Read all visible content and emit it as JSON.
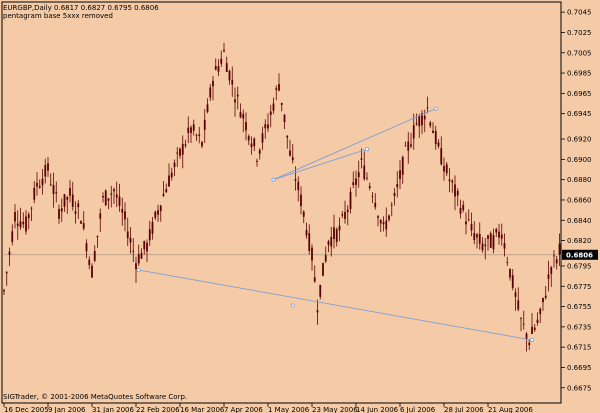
{
  "header": {
    "symbol_line": "EURGBP,Daily  0.6817 0.6827 0.6795 0.6806",
    "indicator_line": "pentagram base 5xxx removed"
  },
  "footer": {
    "copyright": "SIGTrader, © 2001-2006 MetaQuotes Software Corp."
  },
  "colors": {
    "background": "#f5cba7",
    "candle": "#5a0000",
    "pattern_line": "#7f9fd4",
    "price_line": "#a08c78",
    "current_price_box": "#000000",
    "current_price_text": "#ffffff",
    "axis": "#000000"
  },
  "chart_data": {
    "type": "candlestick",
    "symbol": "EURGBP",
    "timeframe": "Daily",
    "last_bar": {
      "open": 0.6817,
      "high": 0.6827,
      "low": 0.6795,
      "close": 0.6806
    },
    "current_price": "0.6806",
    "y_axis": {
      "ticks": [
        "0.7045",
        "0.7025",
        "0.7005",
        "0.6985",
        "0.6965",
        "0.6945",
        "0.6920",
        "0.6900",
        "0.6880",
        "0.6860",
        "0.6840",
        "0.6820",
        "0.6795",
        "0.6775",
        "0.6755",
        "0.6735",
        "0.6715",
        "0.6695",
        "0.6675"
      ],
      "tick_values": [
        0.7045,
        0.7025,
        0.7005,
        0.6985,
        0.6965,
        0.6945,
        0.692,
        0.69,
        0.688,
        0.686,
        0.684,
        0.682,
        0.6795,
        0.6775,
        0.6755,
        0.6735,
        0.6715,
        0.6695,
        0.6675
      ],
      "range": [
        0.666,
        0.7055
      ]
    },
    "x_axis": {
      "labels": [
        "16 Dec 2005",
        "9 Jan 2006",
        "31 Jan 2006",
        "22 Feb 2006",
        "16 Mar 2006",
        "7 Apr 2006",
        "1 May 2006",
        "23 May 2006",
        "14 Jun 2006",
        "6 Jul 2006",
        "28 Jul 2006",
        "21 Aug 2006"
      ],
      "label_bar_index": [
        0,
        16,
        32,
        48,
        64,
        80,
        96,
        112,
        128,
        144,
        160,
        176
      ],
      "bar_count": 183
    },
    "path_points": [
      [
        0,
        0.677
      ],
      [
        4,
        0.6845
      ],
      [
        8,
        0.6835
      ],
      [
        12,
        0.6875
      ],
      [
        16,
        0.689
      ],
      [
        20,
        0.685
      ],
      [
        24,
        0.6865
      ],
      [
        28,
        0.6845
      ],
      [
        32,
        0.679
      ],
      [
        36,
        0.686
      ],
      [
        40,
        0.687
      ],
      [
        44,
        0.684
      ],
      [
        48,
        0.68
      ],
      [
        52,
        0.6815
      ],
      [
        56,
        0.685
      ],
      [
        60,
        0.688
      ],
      [
        64,
        0.6905
      ],
      [
        68,
        0.693
      ],
      [
        72,
        0.6915
      ],
      [
        76,
        0.698
      ],
      [
        80,
        0.7005
      ],
      [
        84,
        0.6965
      ],
      [
        88,
        0.6935
      ],
      [
        92,
        0.6905
      ],
      [
        96,
        0.6935
      ],
      [
        100,
        0.6975
      ],
      [
        104,
        0.6905
      ],
      [
        108,
        0.686
      ],
      [
        112,
        0.6805
      ],
      [
        114,
        0.6758
      ],
      [
        118,
        0.682
      ],
      [
        122,
        0.683
      ],
      [
        126,
        0.686
      ],
      [
        130,
        0.6895
      ],
      [
        134,
        0.687
      ],
      [
        138,
        0.683
      ],
      [
        142,
        0.686
      ],
      [
        146,
        0.6905
      ],
      [
        150,
        0.6935
      ],
      [
        154,
        0.695
      ],
      [
        158,
        0.691
      ],
      [
        162,
        0.688
      ],
      [
        166,
        0.6855
      ],
      [
        170,
        0.683
      ],
      [
        174,
        0.6815
      ],
      [
        178,
        0.682
      ],
      [
        181,
        0.683
      ],
      [
        184,
        0.679
      ],
      [
        188,
        0.674
      ],
      [
        191,
        0.6722
      ],
      [
        195,
        0.6745
      ],
      [
        199,
        0.6795
      ],
      [
        202,
        0.6806
      ]
    ],
    "pattern_lines": [
      {
        "name": "lower-trendline",
        "from": [
          49,
          0.6791
        ],
        "to": [
          192,
          0.6722
        ]
      },
      {
        "name": "upper-trendline",
        "from": [
          98,
          0.688
        ],
        "to": [
          157,
          0.695
        ]
      },
      {
        "name": "middle-marker-segment",
        "from": [
          98,
          0.688
        ],
        "to": [
          132,
          0.691
        ]
      }
    ],
    "pattern_points": [
      [
        49,
        0.6791
      ],
      [
        105,
        0.6756
      ],
      [
        192,
        0.6722
      ],
      [
        98,
        0.688
      ],
      [
        132,
        0.691
      ],
      [
        157,
        0.695
      ]
    ]
  }
}
